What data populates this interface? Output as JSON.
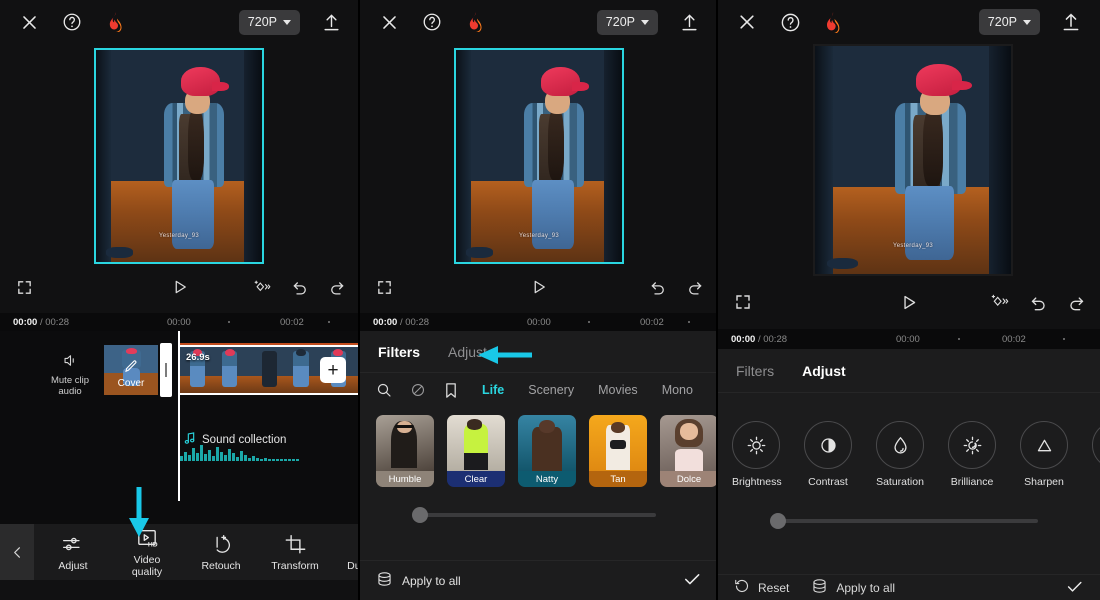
{
  "app": {
    "accent_cyan": "#2ad6e0",
    "background": "#111112",
    "sheet_background": "#1c1c1d"
  },
  "panels": [
    {
      "id": "panel-1",
      "topbar": {
        "close_icon": "close-icon",
        "help_icon": "help-icon",
        "flame_icon": "flame-icon",
        "resolution": "720P",
        "export_icon": "export-upload-icon"
      },
      "controls": {
        "fullscreen_icon": "fullscreen-icon",
        "play_icon": "play-icon",
        "keyframe_icon": "keyframe-icon",
        "undo_icon": "undo-icon",
        "redo_icon": "redo-icon",
        "has_keyframe": true
      },
      "ruler": {
        "current_time": "00:00",
        "total_time": "/ 00:28",
        "ticks": [
          "00:00",
          "00:02"
        ]
      },
      "timeline": {
        "mute_label": "Mute clip audio",
        "cover_label": "Cover",
        "clip_duration": "26.9s",
        "add_label": "+",
        "audio_label": "Sound collection"
      },
      "toolbar": {
        "back_icon": "chevron-left-icon",
        "tools": [
          {
            "label": "Adjust",
            "icon": "sliders-icon"
          },
          {
            "label": "Video quality",
            "icon": "video-hd-icon"
          },
          {
            "label": "Retouch",
            "icon": "retouch-icon"
          },
          {
            "label": "Transform",
            "icon": "crop-icon"
          },
          {
            "label": "Duplicate",
            "icon": "duplicate-icon"
          }
        ]
      },
      "annotation": {
        "type": "arrow-down",
        "points_to": "Video quality"
      }
    },
    {
      "id": "panel-2",
      "topbar": {
        "close_icon": "close-icon",
        "help_icon": "help-icon",
        "flame_icon": "flame-icon",
        "resolution": "720P",
        "export_icon": "export-upload-icon"
      },
      "controls": {
        "fullscreen_icon": "fullscreen-icon",
        "play_icon": "play-icon",
        "undo_icon": "undo-icon",
        "redo_icon": "redo-icon",
        "has_keyframe": false
      },
      "ruler": {
        "current_time": "00:00",
        "total_time": "/ 00:28",
        "ticks": [
          "00:00",
          "00:02"
        ]
      },
      "sheet": {
        "tabs": [
          {
            "label": "Filters",
            "active": true
          },
          {
            "label": "Adjust",
            "active": false
          }
        ],
        "tool_icons": [
          "search-icon",
          "none-icon",
          "bookmark-icon"
        ],
        "categories": [
          {
            "label": "Life",
            "active": true
          },
          {
            "label": "Scenery",
            "active": false
          },
          {
            "label": "Movies",
            "active": false
          },
          {
            "label": "Mono",
            "active": false
          }
        ],
        "filters": [
          {
            "name": "Humble",
            "band": "#8e8378",
            "thumb_top": "#8a8378",
            "thumb_bottom": "#3a3430"
          },
          {
            "name": "Clear",
            "band": "#1c2f73",
            "thumb_top": "#ddd8cf",
            "thumb_bottom": "#b9b3a7"
          },
          {
            "name": "Natty",
            "band": "#0d5b70",
            "thumb_top": "#2f7c99",
            "thumb_bottom": "#145064"
          },
          {
            "name": "Tan",
            "band": "#b4650f",
            "thumb_top": "#f2a11d",
            "thumb_bottom": "#e08a12"
          },
          {
            "name": "Dolce",
            "band": "#9d8376",
            "thumb_top": "#9a8c86",
            "thumb_bottom": "#766760"
          }
        ],
        "slider_value": 0,
        "apply_label": "Apply to all",
        "apply_icon": "layers-stack-icon",
        "confirm_icon": "check-icon"
      },
      "annotation": {
        "type": "arrow-left",
        "points_to": "Adjust"
      }
    },
    {
      "id": "panel-3",
      "topbar": {
        "close_icon": "close-icon",
        "help_icon": "help-icon",
        "flame_icon": "flame-icon",
        "resolution": "720P",
        "export_icon": "export-upload-icon"
      },
      "controls": {
        "fullscreen_icon": "fullscreen-icon",
        "play_icon": "play-icon",
        "keyframe_icon": "keyframe-icon",
        "undo_icon": "undo-icon",
        "redo_icon": "redo-icon",
        "has_keyframe": true
      },
      "ruler": {
        "current_time": "00:00",
        "total_time": "/ 00:28",
        "ticks": [
          "00:00",
          "00:02"
        ]
      },
      "sheet": {
        "tabs": [
          {
            "label": "Filters",
            "active": false
          },
          {
            "label": "Adjust",
            "active": true
          }
        ],
        "adjustments": [
          {
            "label": "Brightness",
            "icon": "brightness-icon"
          },
          {
            "label": "Contrast",
            "icon": "contrast-icon"
          },
          {
            "label": "Saturation",
            "icon": "saturation-drop-icon"
          },
          {
            "label": "Brilliance",
            "icon": "brilliance-icon"
          },
          {
            "label": "Sharpen",
            "icon": "sharpen-triangle-icon"
          }
        ],
        "slider_value": 0,
        "reset_label": "Reset",
        "reset_icon": "reset-icon",
        "apply_label": "Apply to all",
        "apply_icon": "layers-stack-icon",
        "confirm_icon": "check-icon"
      }
    }
  ],
  "video": {
    "watermark": "Yesterday_93"
  }
}
